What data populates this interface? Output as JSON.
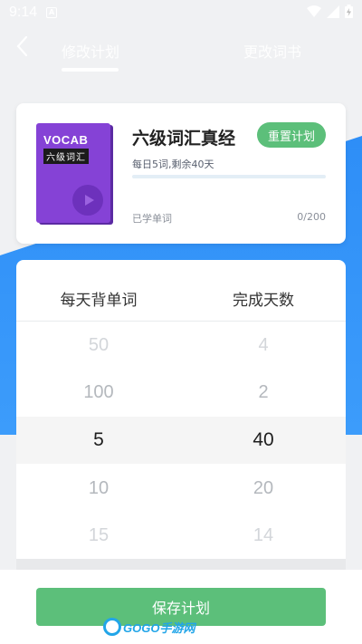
{
  "status_bar": {
    "time": "9:14",
    "notification_letter": "A"
  },
  "header": {
    "tabs": [
      {
        "label": "修改计划",
        "active": true
      },
      {
        "label": "更改词书",
        "active": false
      }
    ]
  },
  "book": {
    "cover_title": "VOCAB",
    "cover_subtitle": "六级词汇",
    "name": "六级词汇真经",
    "reset_label": "重置计划",
    "plan_desc": "每日5词,剩余40天",
    "progress_fraction": 0,
    "learned_label": "已学单词",
    "learned_count": "0/200"
  },
  "picker": {
    "col_words_title": "每天背单词",
    "col_days_title": "完成天数",
    "rows": [
      {
        "words": "50",
        "days": "4"
      },
      {
        "words": "100",
        "days": "2"
      },
      {
        "words": "5",
        "days": "40",
        "selected": true
      },
      {
        "words": "10",
        "days": "20"
      },
      {
        "words": "15",
        "days": "14"
      }
    ]
  },
  "footer": {
    "save_label": "保存计划",
    "watermark": "GOGO手游网"
  },
  "colors": {
    "accent_green": "#5cbf7a",
    "accent_blue": "#2e8ef7",
    "cover_purple": "#8542d6"
  }
}
